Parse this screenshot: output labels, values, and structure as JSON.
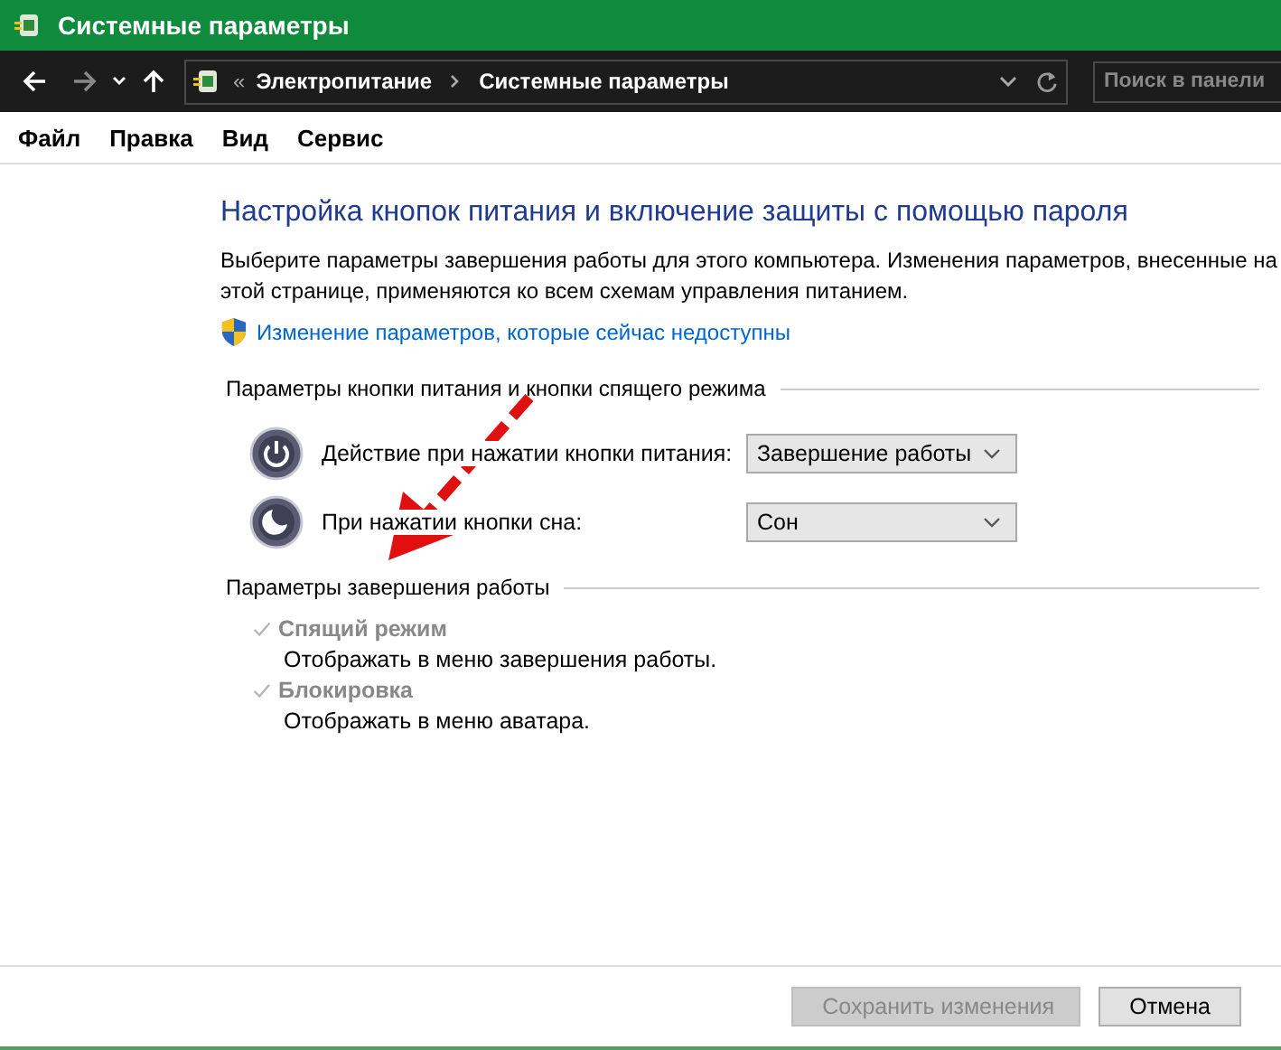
{
  "window": {
    "title": "Системные параметры"
  },
  "address_bar": {
    "overflow": "«",
    "breadcrumbs": [
      "Электропитание",
      "Системные параметры"
    ],
    "search_placeholder": "Поиск в панели"
  },
  "menu": [
    "Файл",
    "Правка",
    "Вид",
    "Сервис"
  ],
  "heading": "Настройка кнопок питания и включение защиты с помощью пароля",
  "description": "Выберите параметры завершения работы для этого компьютера. Изменения параметров, внесенные на этой странице, применяются ко всем схемам управления питанием.",
  "admin_link": "Изменение параметров, которые сейчас недоступны",
  "button_section": {
    "title": "Параметры кнопки питания и кнопки спящего режима",
    "actions": [
      {
        "kind": "power",
        "label": "Действие при нажатии кнопки питания:",
        "value": "Завершение работы"
      },
      {
        "kind": "sleep",
        "label": "При нажатии кнопки сна:",
        "value": "Сон"
      }
    ]
  },
  "shutdown_section": {
    "title": "Параметры завершения работы",
    "options": [
      {
        "label": "Спящий режим",
        "description": "Отображать в меню завершения работы.",
        "checked": true,
        "disabled": true
      },
      {
        "label": "Блокировка",
        "description": "Отображать в меню аватара.",
        "checked": true,
        "disabled": true
      }
    ]
  },
  "buttons": [
    {
      "label": "Сохранить изменения",
      "disabled": true
    },
    {
      "label": "Отмена",
      "disabled": false
    }
  ]
}
